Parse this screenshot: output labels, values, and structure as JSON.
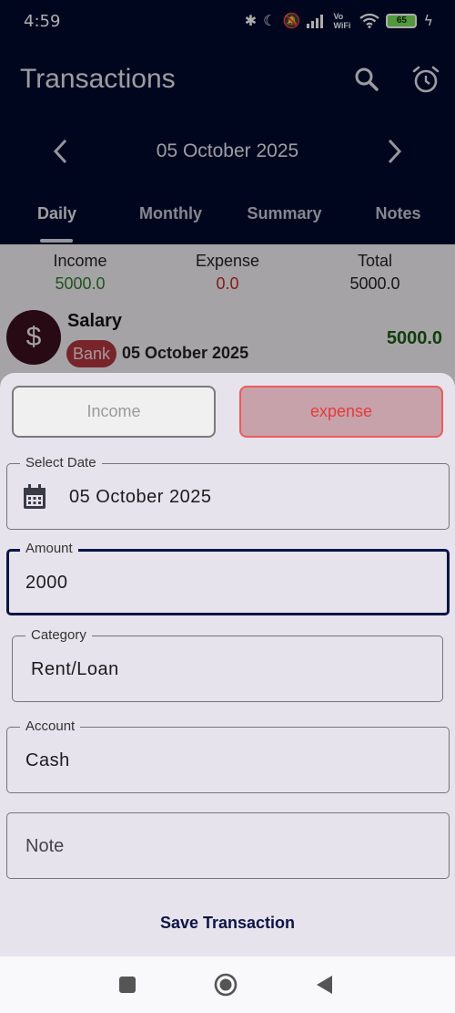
{
  "status_bar": {
    "time": "4:59",
    "icons": [
      "bluetooth-icon",
      "do-not-disturb-icon",
      "mute-icon",
      "signal-icon",
      "vowifi-icon",
      "wifi-icon",
      "battery-icon",
      "charging-icon"
    ],
    "vowifi_label": "Vo WiFi",
    "battery_level": "65"
  },
  "header": {
    "title": "Transactions",
    "search_icon": "search-icon",
    "alarm_icon": "alarm-icon",
    "date": "05 October 2025",
    "tabs": [
      {
        "label": "Daily",
        "active": true
      },
      {
        "label": "Monthly",
        "active": false
      },
      {
        "label": "Summary",
        "active": false
      },
      {
        "label": "Notes",
        "active": false
      }
    ]
  },
  "summary": {
    "income_label": "Income",
    "income_value": "5000.0",
    "expense_label": "Expense",
    "expense_value": "0.0",
    "total_label": "Total",
    "total_value": "5000.0"
  },
  "transaction": {
    "avatar_symbol": "$",
    "name": "Salary",
    "account_chip": "Bank",
    "date": "05 October 2025",
    "amount": "5000.0"
  },
  "sheet": {
    "income_toggle": "Income",
    "expense_toggle": "expense",
    "date_label": "Select Date",
    "date_value": "05 October 2025",
    "amount_label": "Amount",
    "amount_value": "2000",
    "category_label": "Category",
    "category_value": "Rent/Loan",
    "account_label": "Account",
    "account_value": "Cash",
    "note_placeholder": "Note",
    "save_label": "Save Transaction"
  },
  "colors": {
    "header_bg": "#020a2e",
    "income_green": "#2e7d32",
    "expense_red": "#c62828",
    "accent_navy": "#0d1446",
    "expense_toggle_border": "#ec5b5b"
  }
}
